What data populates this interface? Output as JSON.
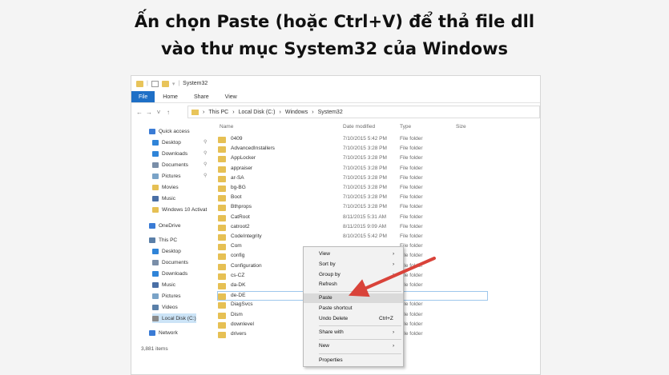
{
  "heading": {
    "line1": "Ấn chọn Paste (hoặc Ctrl+V) để thả file dll",
    "line2": "vào thư mục System32 của Windows"
  },
  "window": {
    "title": "System32",
    "ribbon_tabs": [
      "File",
      "Home",
      "Share",
      "View"
    ],
    "breadcrumb": [
      "This PC",
      "Local Disk (C:)",
      "Windows",
      "System32"
    ]
  },
  "columns": {
    "name": "Name",
    "date": "Date modified",
    "type": "Type",
    "size": "Size"
  },
  "sidebar": {
    "items": [
      {
        "label": "Quick access",
        "icon": "star-icon"
      },
      {
        "label": "Desktop",
        "icon": "desktop-icon",
        "pinned": true
      },
      {
        "label": "Downloads",
        "icon": "download-icon",
        "pinned": true
      },
      {
        "label": "Documents",
        "icon": "document-icon",
        "pinned": true
      },
      {
        "label": "Pictures",
        "icon": "pictures-icon",
        "pinned": true
      },
      {
        "label": "Movies",
        "icon": "folder-icon"
      },
      {
        "label": "Music",
        "icon": "music-icon"
      },
      {
        "label": "Windows 10 Activat",
        "icon": "folder-icon"
      },
      {
        "label": "OneDrive",
        "icon": "cloud-icon"
      },
      {
        "label": "This PC",
        "icon": "computer-icon"
      },
      {
        "label": "Desktop",
        "icon": "desktop-icon"
      },
      {
        "label": "Documents",
        "icon": "document-icon"
      },
      {
        "label": "Downloads",
        "icon": "download-icon"
      },
      {
        "label": "Music",
        "icon": "music-icon"
      },
      {
        "label": "Pictures",
        "icon": "pictures-icon"
      },
      {
        "label": "Videos",
        "icon": "video-icon"
      },
      {
        "label": "Local Disk (C:)",
        "icon": "disk-icon",
        "selected": true
      },
      {
        "label": "Network",
        "icon": "network-icon"
      }
    ],
    "item_count": "3,881 items"
  },
  "files": [
    {
      "name": "0409",
      "date": "7/10/2015 5:42 PM",
      "type": "File folder"
    },
    {
      "name": "AdvancedInstallers",
      "date": "7/10/2015 3:28 PM",
      "type": "File folder"
    },
    {
      "name": "AppLocker",
      "date": "7/10/2015 3:28 PM",
      "type": "File folder"
    },
    {
      "name": "appraiser",
      "date": "7/10/2015 3:28 PM",
      "type": "File folder"
    },
    {
      "name": "ar-SA",
      "date": "7/10/2015 3:28 PM",
      "type": "File folder"
    },
    {
      "name": "bg-BG",
      "date": "7/10/2015 3:28 PM",
      "type": "File folder"
    },
    {
      "name": "Boot",
      "date": "7/10/2015 3:28 PM",
      "type": "File folder"
    },
    {
      "name": "Bthprops",
      "date": "7/10/2015 3:28 PM",
      "type": "File folder"
    },
    {
      "name": "CatRoot",
      "date": "8/11/2015 5:31 AM",
      "type": "File folder"
    },
    {
      "name": "catroot2",
      "date": "8/11/2015 9:09 AM",
      "type": "File folder"
    },
    {
      "name": "CodeIntegrity",
      "date": "8/10/2015 5:42 PM",
      "type": "File folder"
    },
    {
      "name": "Com",
      "date": "",
      "type": "File folder"
    },
    {
      "name": "config",
      "date": "",
      "type": "File folder"
    },
    {
      "name": "Configuration",
      "date": "",
      "type": "File folder"
    },
    {
      "name": "cs-CZ",
      "date": "",
      "type": "File folder"
    },
    {
      "name": "da-DK",
      "date": "",
      "type": "File folder"
    },
    {
      "name": "de-DE",
      "date": "",
      "type": ""
    },
    {
      "name": "DiagSvcs",
      "date": "",
      "type": "File folder"
    },
    {
      "name": "Dism",
      "date": "",
      "type": "File folder"
    },
    {
      "name": "downlevel",
      "date": "",
      "type": "File folder"
    },
    {
      "name": "drivers",
      "date": "",
      "type": "File folder"
    }
  ],
  "context_menu": {
    "items": [
      {
        "label": "View",
        "submenu": true
      },
      {
        "label": "Sort by",
        "submenu": true
      },
      {
        "label": "Group by",
        "submenu": true
      },
      {
        "label": "Refresh"
      },
      {
        "label": "Paste",
        "highlighted": true
      },
      {
        "label": "Paste shortcut"
      },
      {
        "label": "Undo Delete",
        "shortcut": "Ctrl+Z"
      },
      {
        "label": "Share with",
        "submenu": true
      },
      {
        "label": "New",
        "submenu": true
      },
      {
        "label": "Properties"
      }
    ]
  },
  "annotation_arrow_color": "#d9433a",
  "icons": {
    "submenu_arrow": "›",
    "pin": "📌"
  }
}
